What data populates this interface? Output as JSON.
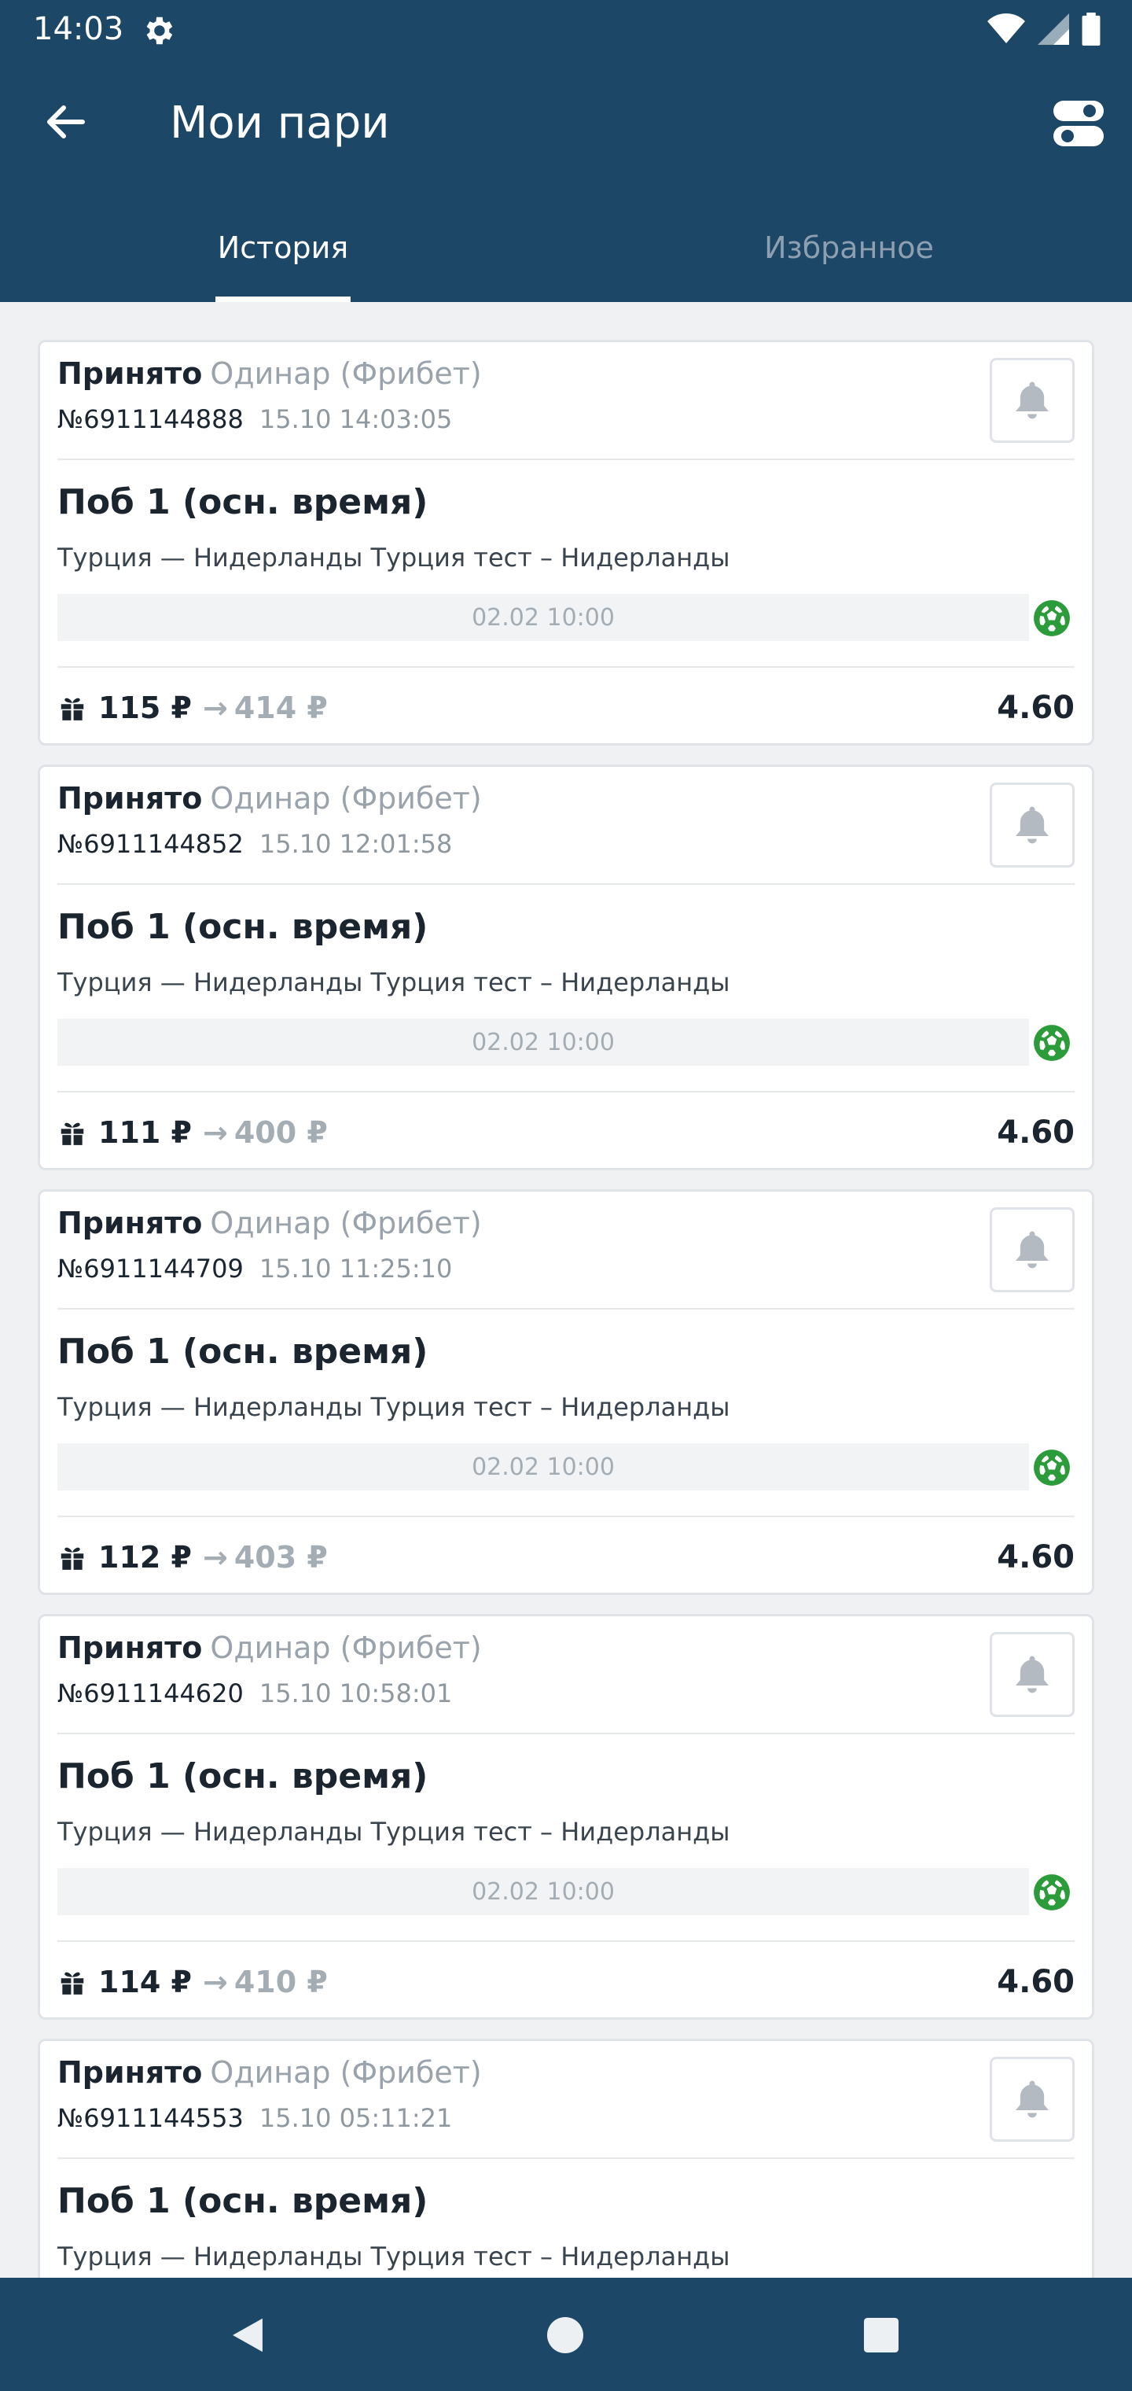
{
  "status_bar": {
    "time": "14:03",
    "icons": [
      "settings-icon",
      "wifi-icon",
      "signal-icon",
      "battery-icon"
    ]
  },
  "app_bar": {
    "title": "Мои пари",
    "back_icon": "arrow-left-icon",
    "filter_icon": "filter-toggle-icon"
  },
  "tabs": [
    {
      "label": "История",
      "active": true
    },
    {
      "label": "Избранное",
      "active": false
    }
  ],
  "colors": {
    "brand": "#1d4766",
    "background": "#eff1f3",
    "sport_icon": "#2c9b3a"
  },
  "bets": [
    {
      "status": "Принято",
      "type": "Одинар (Фрибет)",
      "number": "№6911144888",
      "datetime": "15.10 14:03:05",
      "outcome": "Поб 1 (осн. время)",
      "match": "Турция — Нидерланды Турция тест – Нидерланды",
      "event_date": "02.02 10:00",
      "stake": "115 ₽",
      "arrow": "→",
      "payout": "414 ₽",
      "odds": "4.60"
    },
    {
      "status": "Принято",
      "type": "Одинар (Фрибет)",
      "number": "№6911144852",
      "datetime": "15.10 12:01:58",
      "outcome": "Поб 1 (осн. время)",
      "match": "Турция — Нидерланды Турция тест – Нидерланды",
      "event_date": "02.02 10:00",
      "stake": "111 ₽",
      "arrow": "→",
      "payout": "400 ₽",
      "odds": "4.60"
    },
    {
      "status": "Принято",
      "type": "Одинар (Фрибет)",
      "number": "№6911144709",
      "datetime": "15.10 11:25:10",
      "outcome": "Поб 1 (осн. время)",
      "match": "Турция — Нидерланды Турция тест – Нидерланды",
      "event_date": "02.02 10:00",
      "stake": "112 ₽",
      "arrow": "→",
      "payout": "403 ₽",
      "odds": "4.60"
    },
    {
      "status": "Принято",
      "type": "Одинар (Фрибет)",
      "number": "№6911144620",
      "datetime": "15.10 10:58:01",
      "outcome": "Поб 1 (осн. время)",
      "match": "Турция — Нидерланды Турция тест – Нидерланды",
      "event_date": "02.02 10:00",
      "stake": "114 ₽",
      "arrow": "→",
      "payout": "410 ₽",
      "odds": "4.60"
    },
    {
      "status": "Принято",
      "type": "Одинар (Фрибет)",
      "number": "№6911144553",
      "datetime": "15.10 05:11:21",
      "outcome": "Поб 1 (осн. время)",
      "match": "Турция — Нидерланды Турция тест – Нидерланды",
      "event_date": "",
      "stake": "",
      "arrow": "",
      "payout": "",
      "odds": ""
    }
  ],
  "nav_bar": {
    "icons": [
      "back-triangle-icon",
      "home-circle-icon",
      "recents-square-icon"
    ]
  }
}
